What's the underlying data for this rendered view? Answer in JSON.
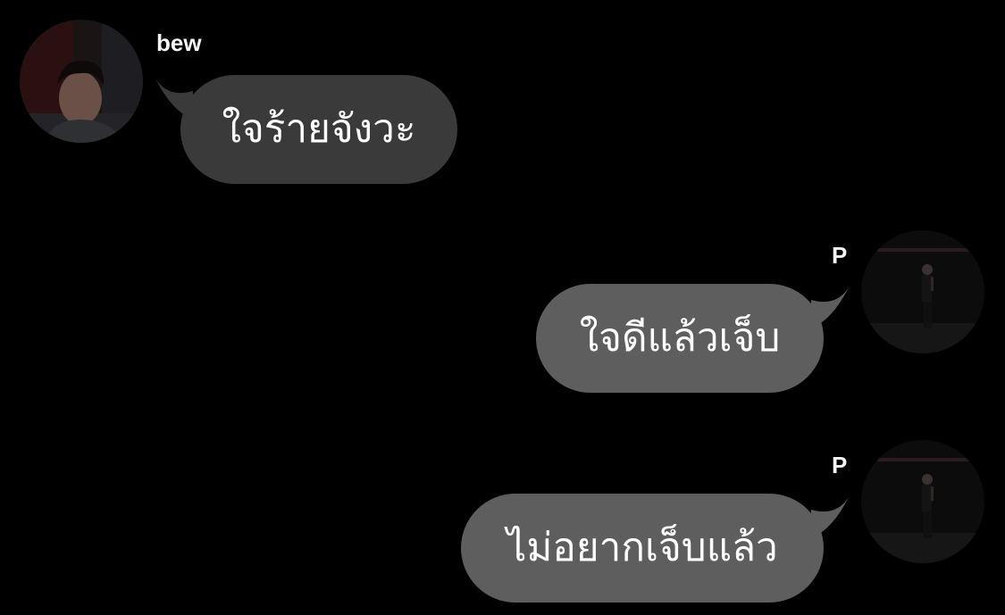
{
  "messages": [
    {
      "sender": "bew",
      "text": "ใจร้ายจังวะ",
      "direction": "incoming",
      "avatar_icon": "profile-photo-icon"
    },
    {
      "sender": "P",
      "text": "ใจดีแล้วเจ็บ",
      "direction": "outgoing",
      "avatar_icon": "profile-photo-icon"
    },
    {
      "sender": "P",
      "text": "ไม่อยากเจ็บแล้ว",
      "direction": "outgoing",
      "avatar_icon": "profile-photo-icon"
    }
  ],
  "colors": {
    "background": "#000000",
    "incoming_bubble": "#3a3a3a",
    "outgoing_bubble": "#5e5e5e",
    "text": "#ffffff"
  }
}
